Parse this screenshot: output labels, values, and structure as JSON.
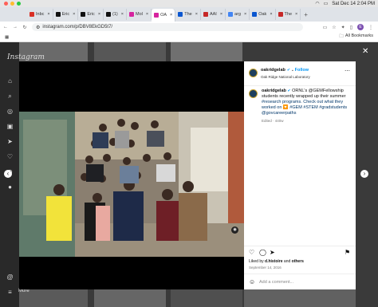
{
  "menubar": {
    "datetime": "Sat Dec 14  2:04 PM"
  },
  "tabs": [
    {
      "label": "Inbc",
      "color": "#d93025"
    },
    {
      "label": "Eric",
      "color": "#111111"
    },
    {
      "label": "Eric",
      "color": "#111111"
    },
    {
      "label": "(1)",
      "color": "#111111"
    },
    {
      "label": "Mol",
      "color": "#d6249f"
    },
    {
      "label": "OA",
      "color": "#d6249f"
    },
    {
      "label": "The",
      "color": "#0b57d0"
    },
    {
      "label": "AAI",
      "color": "#c62828"
    },
    {
      "label": "arg",
      "color": "#4285f4"
    },
    {
      "label": "Oak",
      "color": "#0b57d0"
    },
    {
      "label": "The",
      "color": "#c62828"
    }
  ],
  "active_tab_index": 5,
  "toolbar": {
    "url": "instagram.com/p/DBV8EkGD5t7/"
  },
  "bookmarks": {
    "all_label": "All Bookmarks"
  },
  "instagram": {
    "logo": "Instagram",
    "more_label": "More"
  },
  "post": {
    "username": "oakridgelab",
    "follow_label": "Follow",
    "location": "Oak Ridge National Laboratory",
    "caption_user": "oakridgelab",
    "caption_line1": "ORNL's @GEMFellowship",
    "caption_line2": "students recently wrapped up their summer",
    "caption_line3": "#research programs. Check out what they",
    "caption_line4": "worked on 🔽 #GEM #STEM #gradstudents",
    "caption_line5": "@govcareerpaths",
    "edited": "Edited · 440w",
    "liked_prefix": "Liked by",
    "liked_user": "d.histoire",
    "liked_mid": "and",
    "liked_others": "others",
    "date": "September 14, 2016",
    "comment_placeholder": "Add a comment..."
  },
  "colors": {
    "accent": "#0095f6",
    "overlay": "#1a1a1a"
  }
}
